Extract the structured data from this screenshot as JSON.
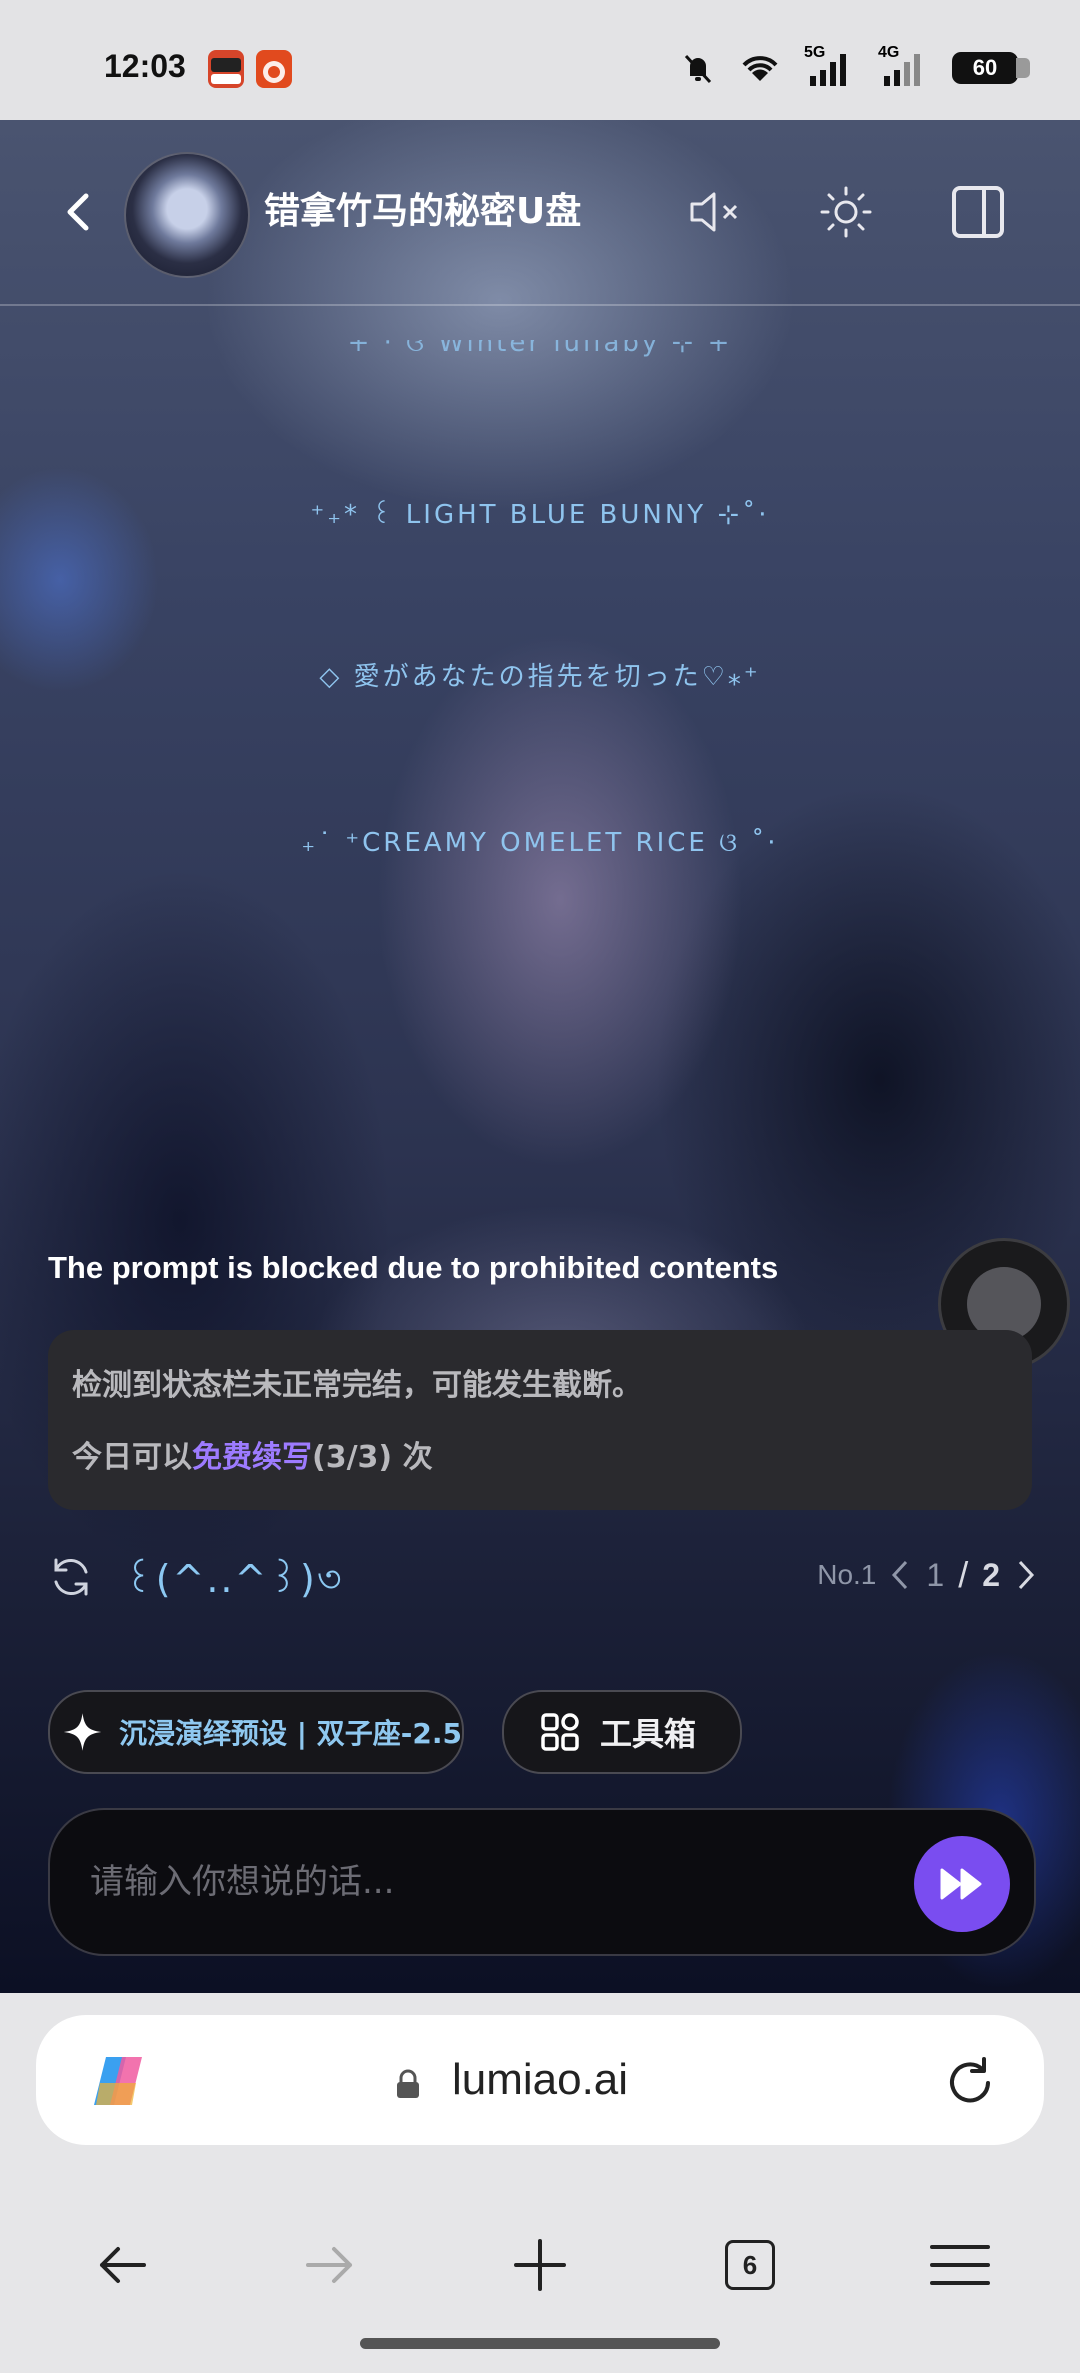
{
  "status_bar": {
    "time": "12:03",
    "network_1": "5G",
    "network_2": "4G",
    "battery": "60"
  },
  "header": {
    "character_name": "错拿竹马的秘密U盘"
  },
  "decorations": [
    "+ · ଓ Winter lullaby ⊹ +",
    "⁺₊* ꒰ LIGHT BLUE BUNNY ⊹˚·",
    "◇ 愛があなたの指先を切った♡⁎⁺",
    "₊˙ ⁺CREAMY OMELET RICE ଓ ˚·"
  ],
  "chat": {
    "blocked_message": "The prompt is blocked due to prohibited contents",
    "notice_line1": "检测到状态栏未正常完结，可能发生截断。",
    "notice_line2_prefix": "今日可以",
    "notice_line2_link": "免费续写",
    "notice_line2_suffix": "(3/3) 次",
    "kaomoji": "꒰(^..^꒱)৩",
    "pager_label": "No.1",
    "pager_current": "1",
    "pager_sep": "/",
    "pager_total": "2"
  },
  "chips": {
    "preset_label": "沉浸演绎预设 | 双子座-2.5",
    "toolbox_label": "工具箱"
  },
  "input": {
    "placeholder": "请输入你想说的话..."
  },
  "browser": {
    "url": "lumiao.ai",
    "tab_count": "6"
  },
  "colors": {
    "accent": "#7a4df0",
    "link": "#9d7bff",
    "decoration_text": "#8fc4ee"
  }
}
